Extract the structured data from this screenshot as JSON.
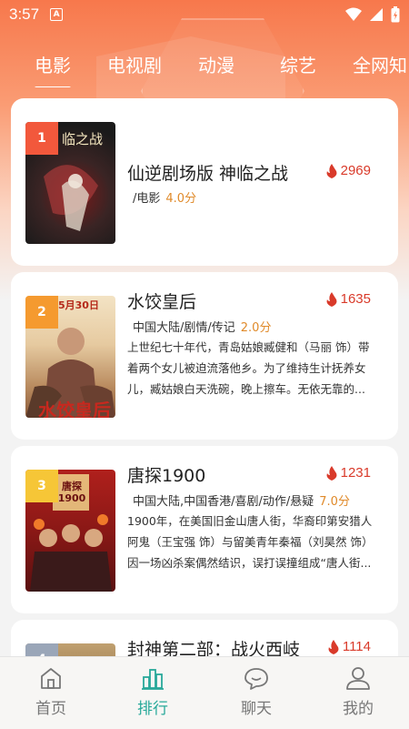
{
  "status": {
    "time": "3:57",
    "notif": "A"
  },
  "tabs": [
    {
      "label": "电影",
      "active": true
    },
    {
      "label": "电视剧",
      "active": false
    },
    {
      "label": "动漫",
      "active": false
    },
    {
      "label": "综艺",
      "active": false
    },
    {
      "label": "全网知",
      "active": false
    }
  ],
  "movies": [
    {
      "rank": "1",
      "title": "仙逆剧场版 神临之战",
      "heat": "2969",
      "meta": "/电影",
      "score": "4.0分",
      "desc": "",
      "poster_text": "临之战"
    },
    {
      "rank": "2",
      "title": "水饺皇后",
      "heat": "1635",
      "meta": "中国大陆/剧情/传记",
      "score": "2.0分",
      "desc": "上世纪七十年代，青岛姑娘臧健和（马丽 饰）带着两个女儿被迫流落他乡。为了维持生计抚养女儿，臧姑娘白天洗碗，晚上擦车。无依无靠的...",
      "poster_text": "5月30日"
    },
    {
      "rank": "3",
      "title": "唐探1900",
      "heat": "1231",
      "meta": "中国大陆,中国香港/喜剧/动作/悬疑",
      "score": "7.0分",
      "desc": "1900年，在美国旧金山唐人街，华裔印第安猎人阿鬼（王宝强 饰）与留美青年秦福（刘昊然 饰）因一场凶杀案偶然结识，误打误撞组成“唐人街...",
      "poster_text": "唐探1900"
    },
    {
      "rank": "4",
      "title": "封神第二部：战火西岐",
      "heat": "1114",
      "meta": "",
      "score": "",
      "desc": "",
      "poster_text": ""
    }
  ],
  "nav": [
    {
      "label": "首页",
      "icon": "home-icon"
    },
    {
      "label": "排行",
      "icon": "ranking-icon",
      "active": true
    },
    {
      "label": "聊天",
      "icon": "chat-icon"
    },
    {
      "label": "我的",
      "icon": "profile-icon"
    }
  ],
  "colors": {
    "accent": "#28a99a",
    "heat": "#d93a2a",
    "score": "#e08a2a",
    "rank1": "#f2583c",
    "rank2": "#f59a2f",
    "rank3": "#f6c637",
    "header": "#f7784c"
  }
}
